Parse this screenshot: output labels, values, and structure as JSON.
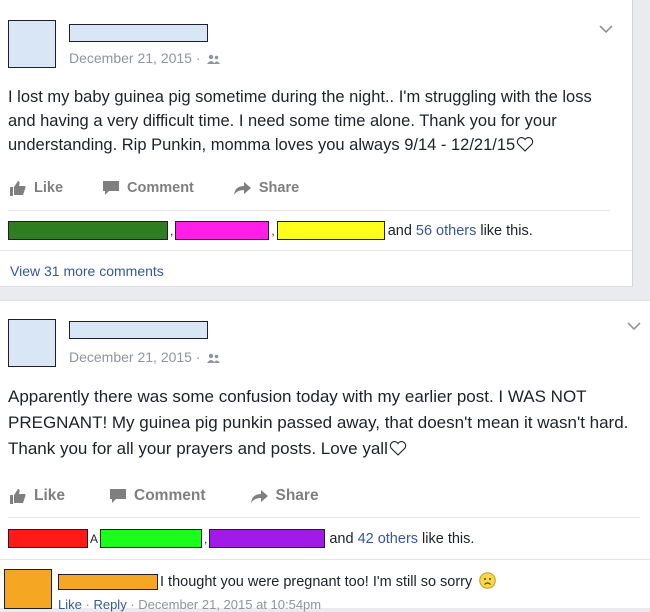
{
  "posts": [
    {
      "date": "December 21, 2015 ·",
      "audience_icon": "friends-icon",
      "text": "I lost my baby guinea pig sometime during the night.. I'm struggling with the loss and having a very difficult time. I need some time alone. Thank you for your understanding. Rip Punkin, momma loves you always 9/14 - 12/21/15",
      "actions": {
        "like": "Like",
        "comment": "Comment",
        "share": "Share"
      },
      "likes": {
        "colors": [
          "#2e7d1f",
          "#ff1fe8",
          "#ffff1a"
        ],
        "separators": [
          ",",
          ","
        ],
        "and": "and",
        "others": "56 others",
        "suffix": "like this."
      },
      "view_more": "View 31 more comments"
    },
    {
      "date": "December 21, 2015 ·",
      "audience_icon": "friends-icon",
      "text": "Apparently there was some confusion today with my earlier post. I WAS NOT PREGNANT! My guinea pig punkin passed away, that doesn't mean it wasn't hard. Thank you for all your prayers and posts. Love yall",
      "actions": {
        "like": "Like",
        "comment": "Comment",
        "share": "Share"
      },
      "likes": {
        "colors": [
          "#ff1a1a",
          "#1aff1a",
          "#a01ae8"
        ],
        "separators": [
          "A",
          ","
        ],
        "and": "and",
        "others": "42 others",
        "suffix": "like this."
      },
      "comment": {
        "text": "I thought you were pregnant too! I'm still so sorry",
        "like": "Like",
        "dot1": "·",
        "reply": "Reply",
        "timestamp": "· December 21, 2015 at 10:54pm"
      }
    }
  ],
  "colors": {
    "accent": "#365899",
    "muted": "#90949c"
  }
}
